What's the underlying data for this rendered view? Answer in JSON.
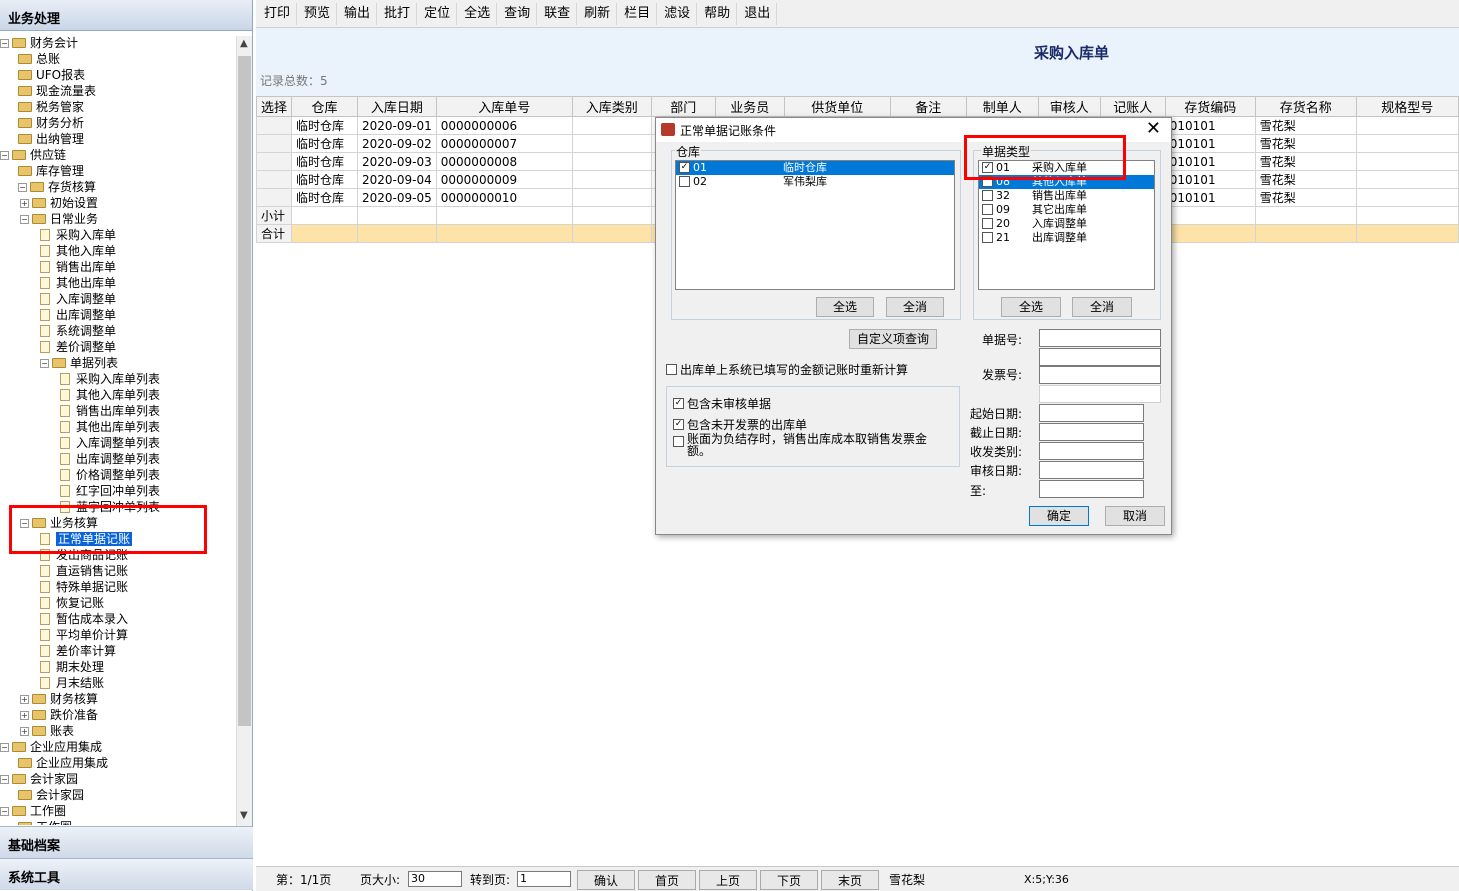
{
  "left": {
    "title": "业务处理",
    "tree": [
      {
        "label": "财务会计",
        "level": 0,
        "type": "folder",
        "exp": "-"
      },
      {
        "label": "总账",
        "level": 1,
        "type": "folder"
      },
      {
        "label": "UFO报表",
        "level": 1,
        "type": "folder"
      },
      {
        "label": "现金流量表",
        "level": 1,
        "type": "folder"
      },
      {
        "label": "税务管家",
        "level": 1,
        "type": "folder"
      },
      {
        "label": "财务分析",
        "level": 1,
        "type": "folder"
      },
      {
        "label": "出纳管理",
        "level": 1,
        "type": "folder"
      },
      {
        "label": "供应链",
        "level": 0,
        "type": "folder",
        "exp": "-"
      },
      {
        "label": "库存管理",
        "level": 1,
        "type": "folder"
      },
      {
        "label": "存货核算",
        "level": 1,
        "type": "folder",
        "exp": "-"
      },
      {
        "label": "初始设置",
        "level": 2,
        "type": "folder",
        "exp": "+"
      },
      {
        "label": "日常业务",
        "level": 2,
        "type": "folder",
        "exp": "-"
      },
      {
        "label": "采购入库单",
        "level": 3,
        "type": "doc"
      },
      {
        "label": "其他入库单",
        "level": 3,
        "type": "doc"
      },
      {
        "label": "销售出库单",
        "level": 3,
        "type": "doc"
      },
      {
        "label": "其他出库单",
        "level": 3,
        "type": "doc"
      },
      {
        "label": "入库调整单",
        "level": 3,
        "type": "doc"
      },
      {
        "label": "出库调整单",
        "level": 3,
        "type": "doc"
      },
      {
        "label": "系统调整单",
        "level": 3,
        "type": "doc"
      },
      {
        "label": "差价调整单",
        "level": 3,
        "type": "doc"
      },
      {
        "label": "单据列表",
        "level": 3,
        "type": "folder",
        "exp": "-"
      },
      {
        "label": "采购入库单列表",
        "level": 4,
        "type": "doc"
      },
      {
        "label": "其他入库单列表",
        "level": 4,
        "type": "doc"
      },
      {
        "label": "销售出库单列表",
        "level": 4,
        "type": "doc"
      },
      {
        "label": "其他出库单列表",
        "level": 4,
        "type": "doc"
      },
      {
        "label": "入库调整单列表",
        "level": 4,
        "type": "doc"
      },
      {
        "label": "出库调整单列表",
        "level": 4,
        "type": "doc"
      },
      {
        "label": "价格调整单列表",
        "level": 4,
        "type": "doc"
      },
      {
        "label": "红字回冲单列表",
        "level": 4,
        "type": "doc"
      },
      {
        "label": "蓝字回冲单列表",
        "level": 4,
        "type": "doc"
      },
      {
        "label": "业务核算",
        "level": 2,
        "type": "folder",
        "exp": "-"
      },
      {
        "label": "正常单据记账",
        "level": 3,
        "type": "doc",
        "selected": true
      },
      {
        "label": "发出商品记账",
        "level": 3,
        "type": "doc"
      },
      {
        "label": "直运销售记账",
        "level": 3,
        "type": "doc"
      },
      {
        "label": "特殊单据记账",
        "level": 3,
        "type": "doc"
      },
      {
        "label": "恢复记账",
        "level": 3,
        "type": "doc"
      },
      {
        "label": "暂估成本录入",
        "level": 3,
        "type": "doc"
      },
      {
        "label": "平均单价计算",
        "level": 3,
        "type": "doc"
      },
      {
        "label": "差价率计算",
        "level": 3,
        "type": "doc"
      },
      {
        "label": "期末处理",
        "level": 3,
        "type": "doc"
      },
      {
        "label": "月末结账",
        "level": 3,
        "type": "doc"
      },
      {
        "label": "财务核算",
        "level": 2,
        "type": "folder",
        "exp": "+"
      },
      {
        "label": "跌价准备",
        "level": 2,
        "type": "folder",
        "exp": "+"
      },
      {
        "label": "账表",
        "level": 2,
        "type": "folder",
        "exp": "+"
      },
      {
        "label": "企业应用集成",
        "level": 0,
        "type": "folder",
        "exp": "-"
      },
      {
        "label": "企业应用集成",
        "level": 1,
        "type": "folder"
      },
      {
        "label": "会计家园",
        "level": 0,
        "type": "folder",
        "exp": "-"
      },
      {
        "label": "会计家园",
        "level": 1,
        "type": "folder"
      },
      {
        "label": "工作圈",
        "level": 0,
        "type": "folder",
        "exp": "-"
      },
      {
        "label": "工作圈",
        "level": 1,
        "type": "folder"
      }
    ],
    "panel_basic": "基础档案",
    "panel_tools": "系统工具"
  },
  "toolbar": [
    "打印",
    "预览",
    "输出",
    "批打",
    "定位",
    "全选",
    "查询",
    "联查",
    "刷新",
    "栏目",
    "滤设",
    "帮助",
    "退出"
  ],
  "header": {
    "title": "采购入库单",
    "record_count": "记录总数：5"
  },
  "grid": {
    "columns": [
      "选择",
      "仓库",
      "入库日期",
      "入库单号",
      "入库类别",
      "部门",
      "业务员",
      "供货单位",
      "备注",
      "制单人",
      "审核人",
      "记账人",
      "存货编码",
      "存货名称",
      "规格型号"
    ],
    "rows": [
      [
        "",
        "临时仓库",
        "2020-09-01",
        "0000000006",
        "",
        "",
        "",
        "",
        "",
        "",
        "",
        "",
        "010101",
        "雪花梨",
        ""
      ],
      [
        "",
        "临时仓库",
        "2020-09-02",
        "0000000007",
        "",
        "",
        "",
        "",
        "",
        "",
        "",
        "",
        "010101",
        "雪花梨",
        ""
      ],
      [
        "",
        "临时仓库",
        "2020-09-03",
        "0000000008",
        "",
        "",
        "",
        "",
        "",
        "",
        "",
        "",
        "010101",
        "雪花梨",
        ""
      ],
      [
        "",
        "临时仓库",
        "2020-09-04",
        "0000000009",
        "",
        "",
        "",
        "",
        "",
        "",
        "",
        "",
        "010101",
        "雪花梨",
        ""
      ],
      [
        "",
        "临时仓库",
        "2020-09-05",
        "0000000010",
        "",
        "",
        "",
        "",
        "",
        "",
        "",
        "",
        "010101",
        "雪花梨",
        ""
      ]
    ],
    "subtotal_label": "小计",
    "total_label": "合计"
  },
  "status": {
    "page": "第：1/1页",
    "page_size_label": "页大小:",
    "page_size": "30",
    "goto_label": "转到页:",
    "goto": "1",
    "confirm": "确认",
    "first": "首页",
    "prev": "上页",
    "next": "下页",
    "last": "末页",
    "item": "雪花梨",
    "coords": "X:5;Y:36"
  },
  "dialog": {
    "title": "正常单据记账条件",
    "warehouse_label": "仓库",
    "warehouses": [
      {
        "code": "01",
        "name": "临时仓库",
        "checked": true,
        "highlight": true
      },
      {
        "code": "02",
        "name": "军伟梨库",
        "checked": false,
        "highlight": false
      }
    ],
    "doctype_label": "单据类型",
    "doctypes": [
      {
        "code": "01",
        "name": "采购入库单",
        "checked": true,
        "highlight": false
      },
      {
        "code": "08",
        "name": "其他入库单",
        "checked": false,
        "highlight": true
      },
      {
        "code": "32",
        "name": "销售出库单",
        "checked": false,
        "highlight": false
      },
      {
        "code": "09",
        "name": "其它出库单",
        "checked": false,
        "highlight": false
      },
      {
        "code": "20",
        "name": "入库调整单",
        "checked": false,
        "highlight": false
      },
      {
        "code": "21",
        "name": "出库调整单",
        "checked": false,
        "highlight": false
      }
    ],
    "select_all": "全选",
    "deselect_all": "全消",
    "custom_query": "自定义项查询",
    "recalc": "出库单上系统已填写的金额记账时重新计算",
    "opt_unaudited": "包含未审核单据",
    "opt_uninvoiced": "包含未开发票的出库单",
    "opt_negative": "账面为负结存时，销售出库成本取销售发票金额。",
    "fields": [
      "单据号:",
      "发票号:",
      "起始日期:",
      "截止日期:",
      "收发类别:",
      "审核日期:",
      "至:"
    ],
    "ok": "确定",
    "cancel": "取消"
  }
}
